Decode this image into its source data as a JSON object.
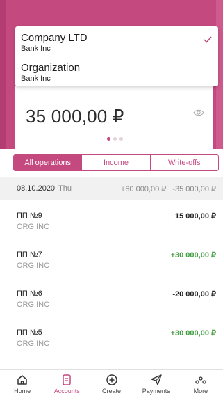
{
  "colors": {
    "accent": "#c4497f",
    "positive": "#3f9c3f",
    "text": "#222222",
    "muted": "#999999"
  },
  "account_picker": {
    "items": [
      {
        "name": "Company LTD",
        "bank": "Bank Inc",
        "selected": true
      },
      {
        "name": "Organization",
        "bank": "Bank Inc",
        "selected": false
      }
    ]
  },
  "balance": {
    "amount": "35 000,00 ₽",
    "icon": "eye-icon",
    "page_index": 1,
    "page_count": 3
  },
  "filter_tabs": [
    {
      "label": "All operations",
      "active": true
    },
    {
      "label": "Income",
      "active": false
    },
    {
      "label": "Write-offs",
      "active": false
    }
  ],
  "day_group": {
    "date": "08.10.2020",
    "weekday": "Thu",
    "income_total": "+60 000,00 ₽",
    "writeoff_total": "-35 000,00 ₽"
  },
  "operations": [
    {
      "title": "ПП №9",
      "org": "ORG INC",
      "amount": "15 000,00 ₽",
      "positive": false
    },
    {
      "title": "ПП №7",
      "org": "ORG INC",
      "amount": "+30 000,00 ₽",
      "positive": true
    },
    {
      "title": "ПП №6",
      "org": "ORG INC",
      "amount": "-20 000,00 ₽",
      "positive": false
    },
    {
      "title": "ПП №5",
      "org": "ORG INC",
      "amount": "+30 000,00 ₽",
      "positive": true
    }
  ],
  "tabbar": [
    {
      "label": "Home",
      "icon": "home-icon",
      "active": false
    },
    {
      "label": "Accounts",
      "icon": "accounts-icon",
      "active": true
    },
    {
      "label": "Create",
      "icon": "create-icon",
      "active": false
    },
    {
      "label": "Payments",
      "icon": "payments-icon",
      "active": false
    },
    {
      "label": "More",
      "icon": "more-icon",
      "active": false
    }
  ]
}
